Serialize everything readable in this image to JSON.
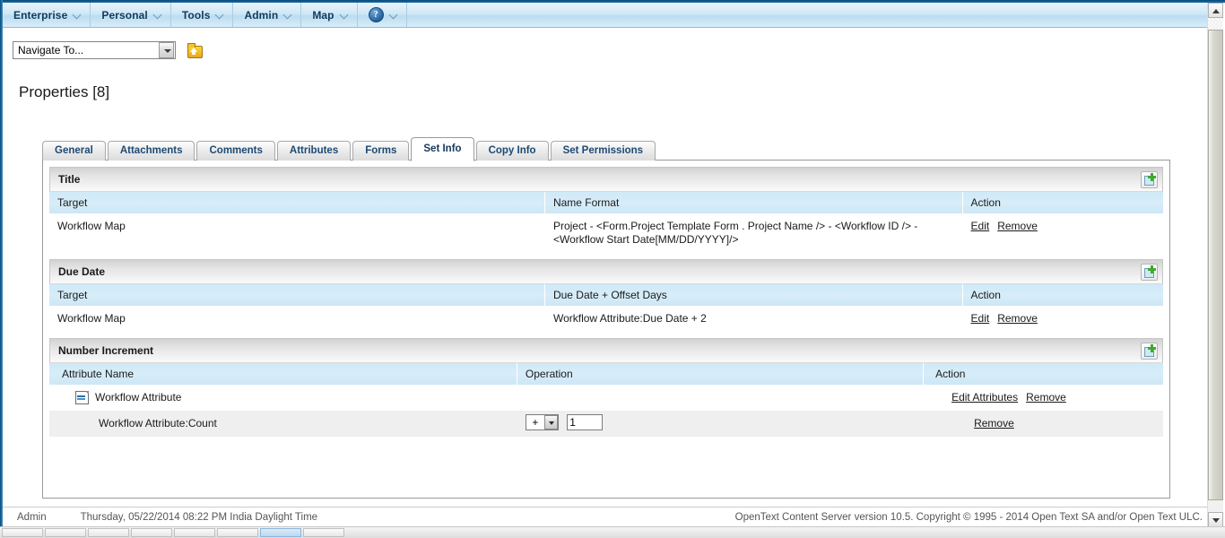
{
  "menubar": {
    "items": [
      {
        "label": "Enterprise",
        "caret": true,
        "icon": null
      },
      {
        "label": "Personal",
        "caret": true,
        "icon": null
      },
      {
        "label": "Tools",
        "caret": true,
        "icon": null
      },
      {
        "label": "Admin",
        "caret": true,
        "icon": null
      },
      {
        "label": "Map",
        "caret": true,
        "icon": null
      },
      {
        "label": "",
        "caret": true,
        "icon": "help-icon",
        "icon_glyph": "?"
      }
    ]
  },
  "navigate": {
    "select_value": "Navigate To...",
    "dropdown_icon": "chevron-down-icon",
    "folder_up_icon": "folder-up-icon"
  },
  "page": {
    "title": "Properties [8]"
  },
  "tabs": [
    {
      "label": "General",
      "active": false
    },
    {
      "label": "Attachments",
      "active": false
    },
    {
      "label": "Comments",
      "active": false
    },
    {
      "label": "Attributes",
      "active": false
    },
    {
      "label": "Forms",
      "active": false
    },
    {
      "label": "Set Info",
      "active": true
    },
    {
      "label": "Copy Info",
      "active": false
    },
    {
      "label": "Set Permissions",
      "active": false
    }
  ],
  "sections": {
    "title": {
      "heading": "Title",
      "add_icon": "add-item-icon",
      "columns": [
        "Target",
        "Name Format",
        "Action"
      ],
      "rows": [
        {
          "target": "Workflow Map",
          "value": "Project - <Form.Project Template Form . Project Name /> - <Workflow ID /> - <Workflow Start Date[MM/DD/YYYY]/>",
          "actions": [
            "Edit",
            "Remove"
          ]
        }
      ]
    },
    "due_date": {
      "heading": "Due Date",
      "add_icon": "add-item-icon",
      "columns": [
        "Target",
        "Due Date + Offset Days",
        "Action"
      ],
      "rows": [
        {
          "target": "Workflow Map",
          "value": "Workflow Attribute:Due Date + 2",
          "actions": [
            "Edit",
            "Remove"
          ]
        }
      ]
    },
    "number_increment": {
      "heading": "Number Increment",
      "add_icon": "add-item-icon",
      "columns": [
        "Attribute Name",
        "Operation",
        "Action"
      ],
      "group_row": {
        "icon": "attribute-set-icon",
        "name": "Workflow Attribute",
        "actions": [
          "Edit Attributes",
          "Remove"
        ]
      },
      "detail_row": {
        "name": "Workflow Attribute:Count",
        "operation_value": "+",
        "operation_dropdown_icon": "chevron-down-icon",
        "amount_value": "1",
        "actions": [
          "Remove"
        ]
      }
    }
  },
  "footer": {
    "user": "Admin",
    "timestamp": "Thursday, 05/22/2014 08:22 PM India Daylight Time",
    "copyright": "OpenText Content Server version 10.5. Copyright © 1995 - 2014 Open Text SA and/or Open Text ULC."
  },
  "scrollbar": {
    "up_icon": "scroll-up-arrow-icon",
    "down_icon": "scroll-down-arrow-icon"
  },
  "colors": {
    "chrome_blue": "#1b6ea8",
    "menu_text": "#103a5c",
    "column_header": "#d3eaf8",
    "tab_text": "#1d4a73",
    "add_plus_green": "#3faa2e",
    "folder_yellow": "#f3c62e"
  }
}
